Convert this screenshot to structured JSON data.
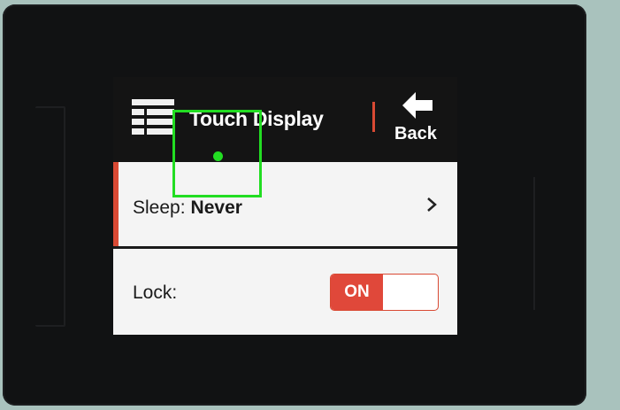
{
  "header": {
    "title": "Touch Display",
    "menu_icon": "menu-grid-icon",
    "back_label": "Back",
    "back_icon": "back-arrow-icon"
  },
  "settings": {
    "sleep": {
      "label": "Sleep:",
      "value": "Never",
      "icon": "chevron-right-icon"
    },
    "lock": {
      "label": "Lock:",
      "toggle_label": "ON",
      "state": "on"
    }
  },
  "colors": {
    "accent": "#d94a34",
    "header_bg": "#141414",
    "row_bg": "#f4f4f4",
    "toggle_on": "#e0483a",
    "highlight": "#22dd22"
  }
}
